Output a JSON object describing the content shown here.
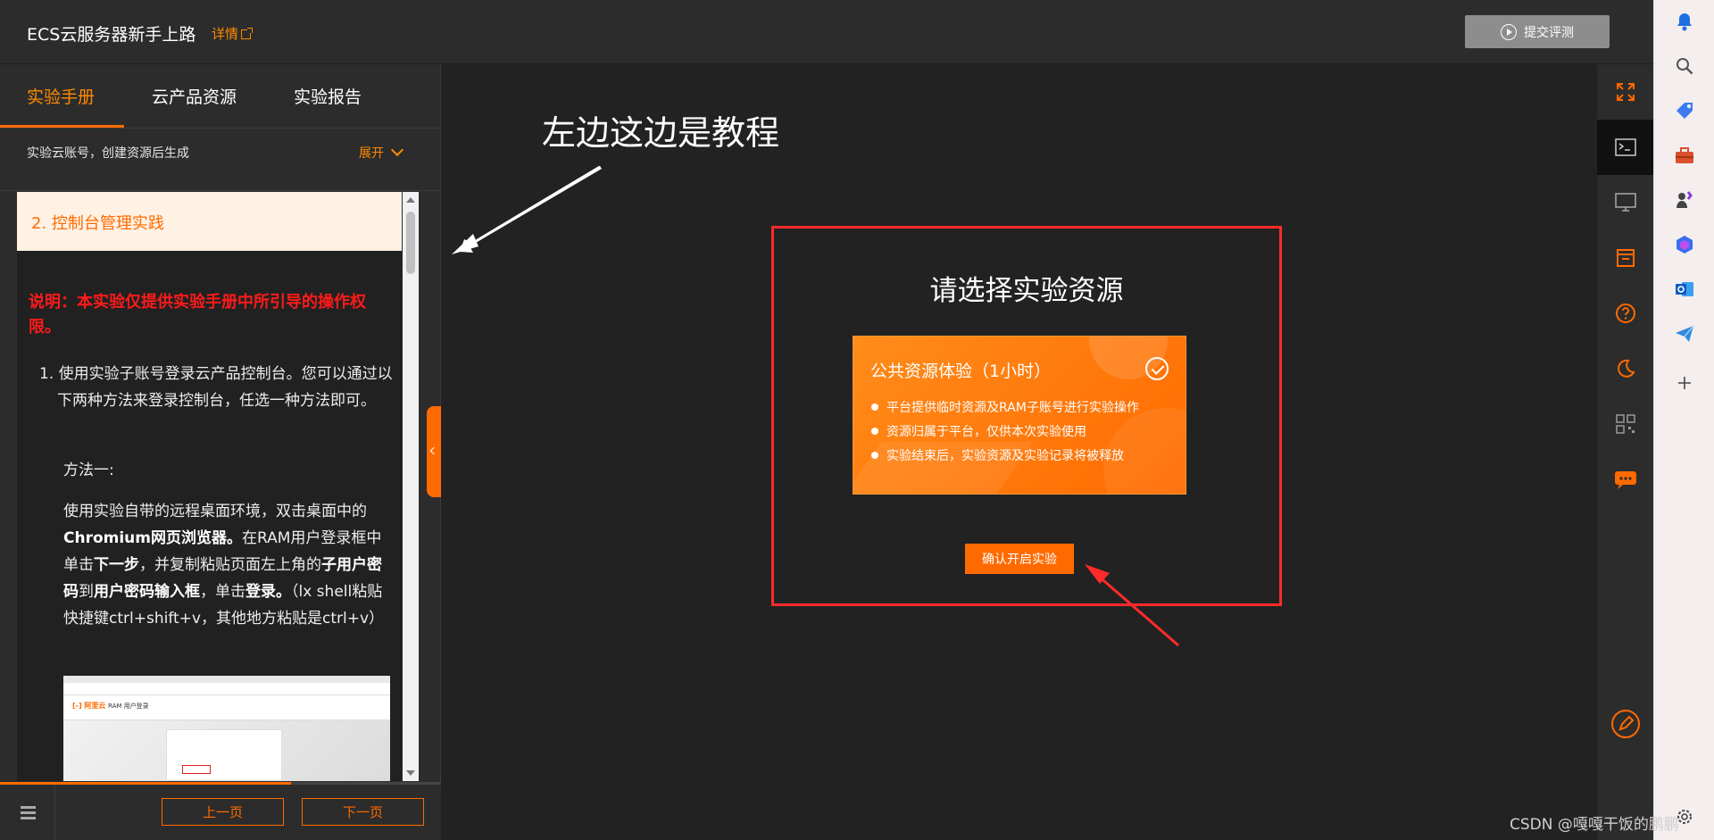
{
  "header": {
    "title": "ECS云服务器新手上路",
    "details_label": "详情",
    "submit_label": "提交评测"
  },
  "left_panel": {
    "tabs": [
      {
        "label": "实验手册",
        "active": true
      },
      {
        "label": "云产品资源",
        "active": false
      },
      {
        "label": "实验报告",
        "active": false
      }
    ],
    "account_text": "实验云账号，创建资源后生成",
    "expand_label": "展开",
    "section_title": "2. 控制台管理实践",
    "notice": "说明：本实验仅提供实验手册中所引导的操作权限。",
    "step1": "1. 使用实验子账号登录云产品控制台。您可以通过以下两种方法来登录控制台，任选一种方法即可。",
    "method_label": "方法一:",
    "method_text": {
      "p1": "使用实验自带的远程桌面环境，双击桌面中的",
      "b1": "Chromium网页浏览器。",
      "p2": "在RAM用户登录框中单击",
      "b2": "下一步",
      "p3": "，并复制粘贴页面左上角的",
      "b3": "子用户密码",
      "p4": "到",
      "b4": "用户密码输入框",
      "p5": "，单击",
      "b5": "登录。",
      "p6": "（lx shell粘贴快捷键ctrl+shift+v，其他地方粘贴是ctrl+v）"
    },
    "thumb": {
      "logo": "[-] 阿里云",
      "heading": "RAM 用户登录"
    },
    "progress": 0.66,
    "prev_label": "上一页",
    "next_label": "下一页"
  },
  "main": {
    "annotation_text": "左边这边是教程",
    "choose_title": "请选择实验资源",
    "resource_card": {
      "title": "公共资源体验（1小时）",
      "bullets": [
        "平台提供临时资源及RAM子账号进行实验操作",
        "资源归属于平台，仅供本次实验使用",
        "实验结束后，实验资源及实验记录将被释放"
      ],
      "selected": true
    },
    "confirm_label": "确认开启实验"
  },
  "tools": [
    "fullscreen-icon",
    "terminal-icon",
    "monitor-icon",
    "archive-icon",
    "help-icon",
    "moon-icon",
    "qrcode-icon",
    "chat-icon",
    "edit-icon"
  ],
  "edge_sidebar": [
    "bell-icon",
    "search-icon",
    "tag-icon",
    "toolbox-icon",
    "games-icon",
    "copilot-icon",
    "outlook-icon",
    "send-icon",
    "plus-icon",
    "settings-icon"
  ],
  "colors": {
    "accent": "#ff6a00",
    "annotation_red": "#ff2a2a",
    "notice_red": "#ff1a1a"
  },
  "watermark": "CSDN @嘎嘎干饭的鹏鹏"
}
